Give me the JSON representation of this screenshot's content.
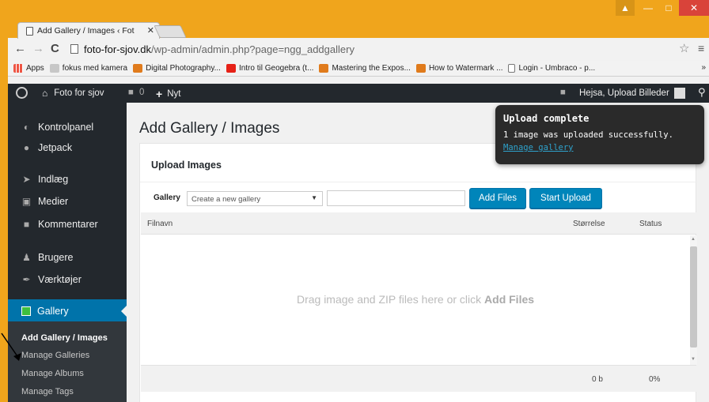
{
  "browser": {
    "tab_title": "Add Gallery / Images ‹ Fot",
    "tab_close": "✕",
    "url_host": "foto-for-sjov.dk",
    "url_path": "/wp-admin/admin.php?page=ngg_addgallery",
    "bookmarks": [
      {
        "label": "Apps",
        "icon": "apps-icon"
      },
      {
        "label": "fokus med kamera",
        "icon": "folder-icon"
      },
      {
        "label": "Digital Photography...",
        "icon": "r-icon"
      },
      {
        "label": "Intro til Geogebra (t...",
        "icon": "youtube-icon"
      },
      {
        "label": "Mastering the Expos...",
        "icon": "r-icon"
      },
      {
        "label": "How to Watermark ...",
        "icon": "r-icon"
      },
      {
        "label": "Login - Umbraco - p...",
        "icon": "document-icon"
      }
    ],
    "bookmarks_more": "»"
  },
  "adminbar": {
    "site_name": "Foto for sjov",
    "comments_count": "0",
    "new_label": "Nyt",
    "greeting": "Hejsa, Upload Billeder"
  },
  "sidebar": {
    "items": [
      {
        "label": "Kontrolpanel",
        "icon": "dashboard-icon"
      },
      {
        "label": "Jetpack",
        "icon": "jetpack-icon"
      },
      {
        "label": "Indlæg",
        "icon": "pin-icon"
      },
      {
        "label": "Medier",
        "icon": "media-icon"
      },
      {
        "label": "Kommentarer",
        "icon": "comment-icon"
      },
      {
        "label": "Brugere",
        "icon": "users-icon"
      },
      {
        "label": "Værktøjer",
        "icon": "tools-icon"
      },
      {
        "label": "Gallery",
        "icon": "gallery-icon"
      }
    ],
    "submenu": [
      "Add Gallery / Images",
      "Manage Galleries",
      "Manage Albums",
      "Manage Tags"
    ]
  },
  "main": {
    "page_title": "Add Gallery / Images",
    "upload_heading": "Upload Images",
    "gallery_label": "Gallery",
    "gallery_select": "Create a new gallery",
    "add_files_button": "Add Files",
    "start_upload_button": "Start Upload",
    "columns": {
      "filename": "Filnavn",
      "size": "Størrelse",
      "status": "Status"
    },
    "drop_text": "Drag image and ZIP files here or click ",
    "drop_text_bold": "Add Files",
    "footer_size": "0 b",
    "footer_status": "0%"
  },
  "tooltip": {
    "title": "Upload complete",
    "message": "1 image was uploaded successfully.",
    "link": "Manage gallery"
  },
  "colors": {
    "browser_frame": "#f0a51c",
    "admin_dark": "#23282d",
    "wp_blue": "#0073aa",
    "button_blue": "#0085ba"
  }
}
